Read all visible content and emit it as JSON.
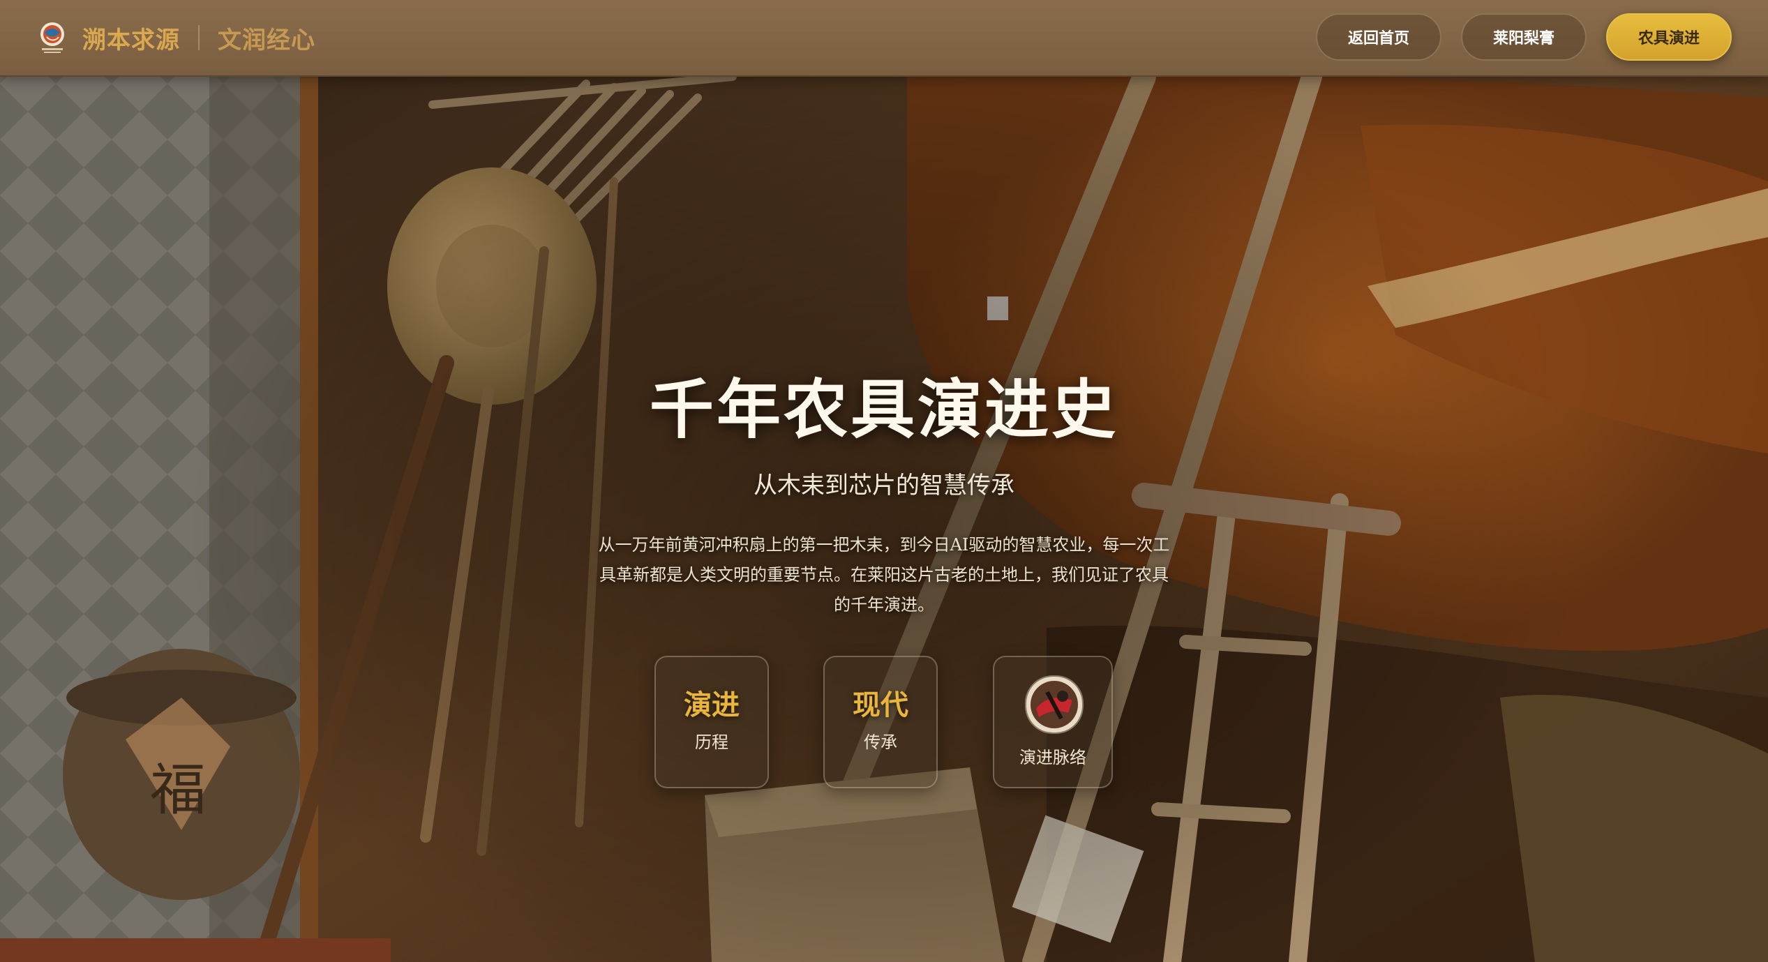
{
  "header": {
    "brand_primary": "溯本求源",
    "brand_secondary": "文润经心",
    "logo_icon": "globe-seal-icon"
  },
  "nav": {
    "items": [
      {
        "label": "返回首页",
        "active": false
      },
      {
        "label": "莱阳梨膏",
        "active": false
      },
      {
        "label": "农具演进",
        "active": true
      }
    ]
  },
  "hero": {
    "title": "千年农具演进史",
    "subtitle": "从木耒到芯片的智慧传承",
    "description": "从一万年前黄河冲积扇上的第一把木耒，到今日AI驱动的智慧农业，每一次工具革新都是人类文明的重要节点。在莱阳这片古老的土地上，我们见证了农具的千年演进。"
  },
  "cards": [
    {
      "big": "演进",
      "small": "历程"
    },
    {
      "big": "现代",
      "small": "传承"
    },
    {
      "small": "演进脉络",
      "icon": "timeline-avatar-icon"
    }
  ],
  "colors": {
    "accent": "#e7bd3e",
    "brand": "#d9a84f",
    "topbar": "#7f6344"
  }
}
